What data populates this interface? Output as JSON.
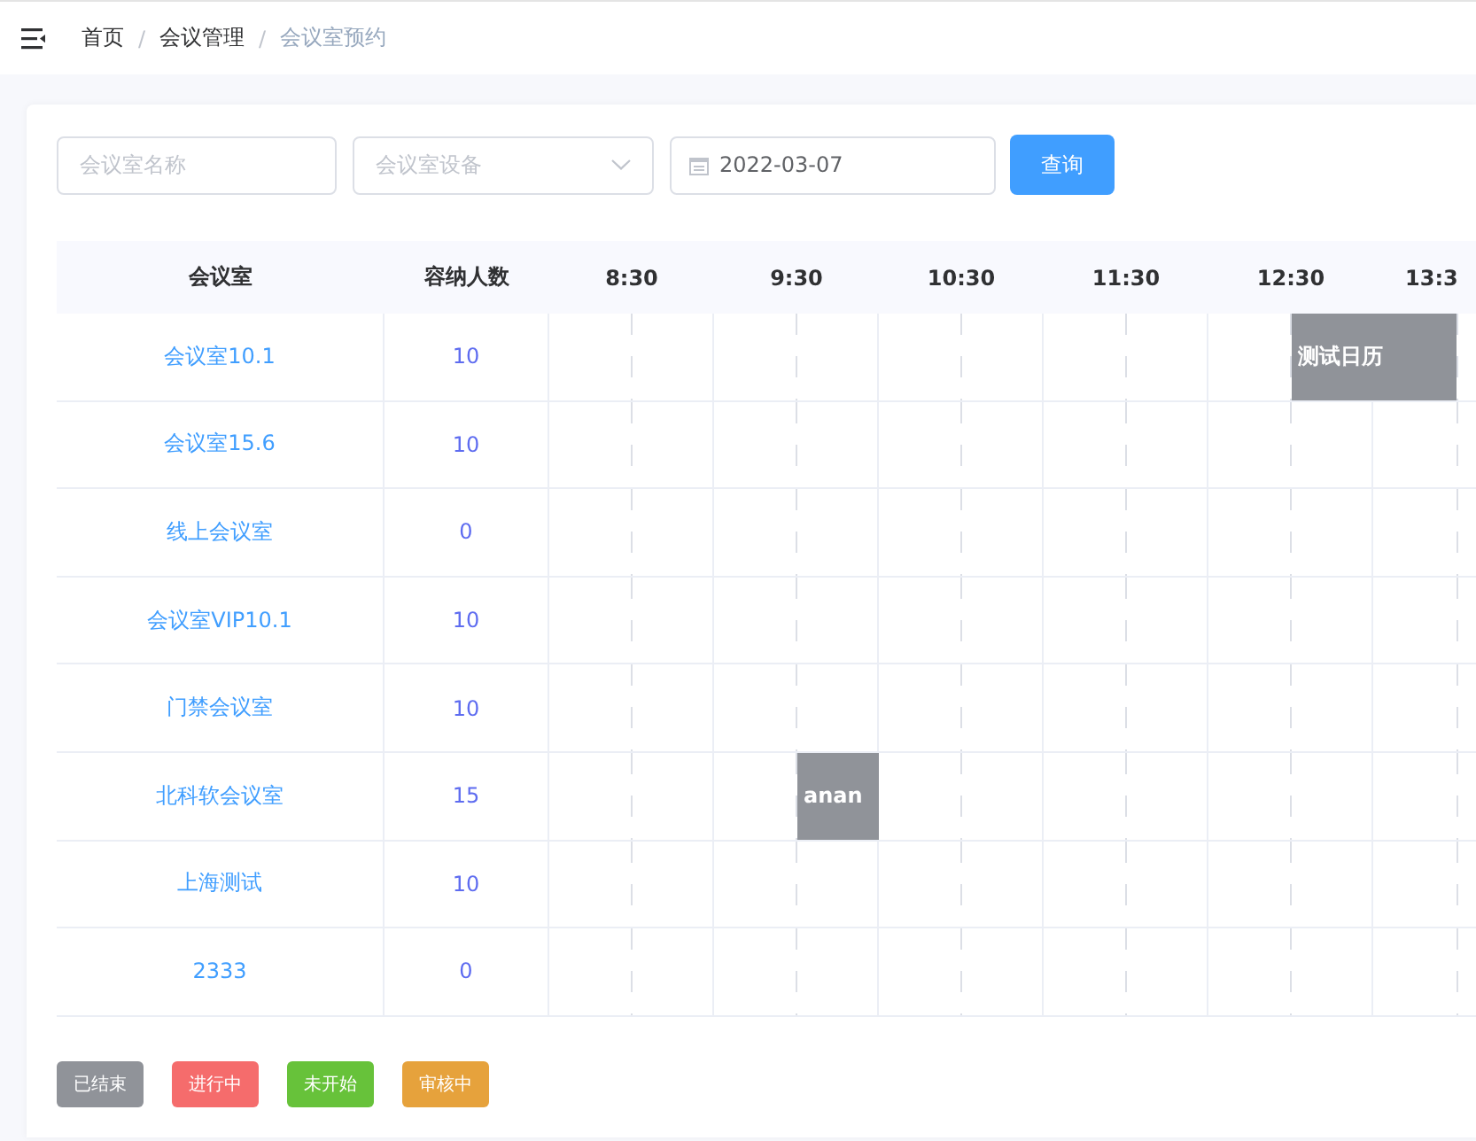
{
  "breadcrumb_separator": "/",
  "breadcrumb": [
    {
      "label": "首页",
      "current": false
    },
    {
      "label": "会议管理",
      "current": false
    },
    {
      "label": "会议室预约",
      "current": true
    }
  ],
  "filters": {
    "name_placeholder": "会议室名称",
    "device_placeholder": "会议室设备",
    "date": "2022-03-07",
    "search_button": "查询"
  },
  "table": {
    "columns": [
      "会议室",
      "容纳人数"
    ],
    "hours": [
      "8:30",
      "9:30",
      "10:30",
      "11:30",
      "12:30",
      "13:3"
    ],
    "rows": [
      {
        "room": "会议室10.1",
        "capacity": "10",
        "events": [
          {
            "title": "测试日历",
            "color": "#909399"
          }
        ]
      },
      {
        "room": "会议室15.6",
        "capacity": "10",
        "events": []
      },
      {
        "room": "线上会议室",
        "capacity": "0",
        "events": []
      },
      {
        "room": "会议室VIP10.1",
        "capacity": "10",
        "events": []
      },
      {
        "room": "门禁会议室",
        "capacity": "10",
        "events": []
      },
      {
        "room": "北科软会议室",
        "capacity": "15",
        "events": [
          {
            "title": "anan",
            "color": "#909399"
          }
        ]
      },
      {
        "room": "上海测试",
        "capacity": "10",
        "events": []
      },
      {
        "room": "2333",
        "capacity": "0",
        "events": []
      }
    ]
  },
  "legend": [
    {
      "label": "已结束",
      "color": "#909399"
    },
    {
      "label": "进行中",
      "color": "#f56c6c"
    },
    {
      "label": "未开始",
      "color": "#67c23a"
    },
    {
      "label": "审核中",
      "color": "#e6a23c"
    }
  ]
}
